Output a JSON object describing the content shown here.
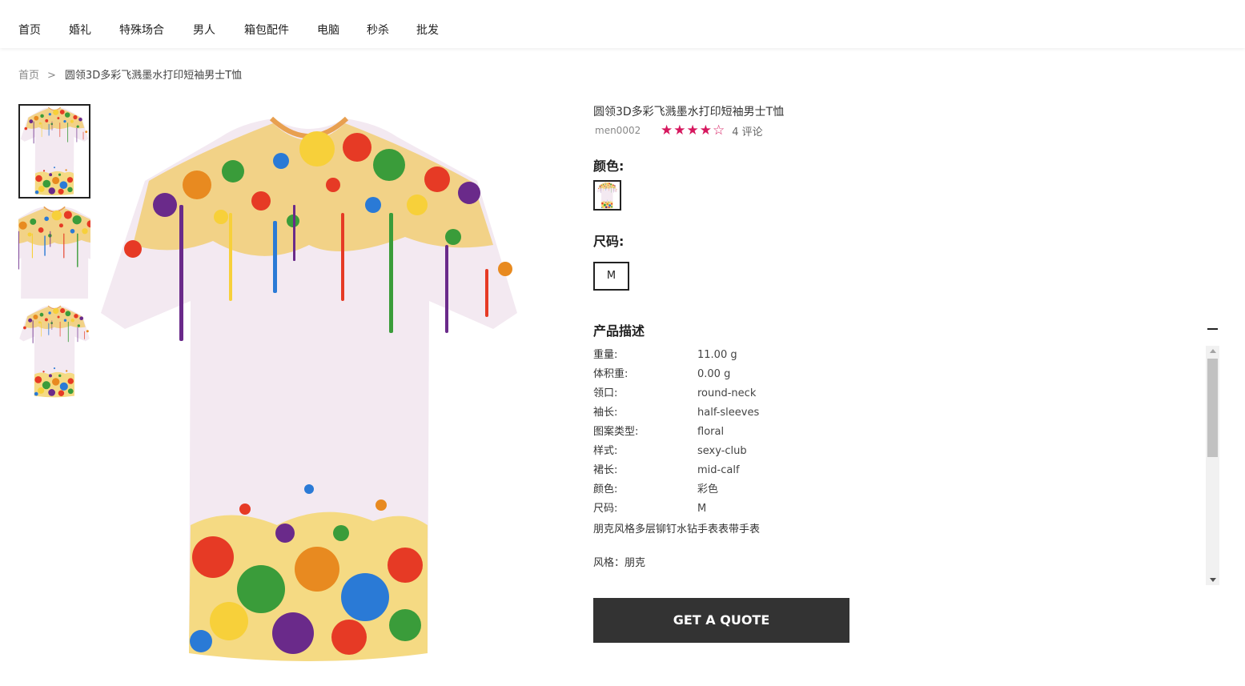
{
  "nav": {
    "items": [
      "首页",
      "婚礼",
      "特殊场合",
      "男人",
      "箱包配件",
      "电脑",
      "秒杀",
      "批发"
    ]
  },
  "breadcrumb": {
    "home": "首页",
    "separator": ">",
    "current": "圆领3D多彩飞溅墨水打印短袖男士T恤"
  },
  "product": {
    "title": "圆领3D多彩飞溅墨水打印短袖男士T恤",
    "sku": "men0002",
    "rating": 4,
    "rating_max": 5,
    "stars_text": "★★★★☆",
    "reviews": "4 评论",
    "color_label": "颜色:",
    "size_label": "尺码:",
    "size_selected": "M",
    "description_title": "产品描述",
    "attributes": [
      {
        "key": "重量:",
        "value": "11.00 g"
      },
      {
        "key": "体积重:",
        "value": "0.00 g"
      },
      {
        "key": "领口:",
        "value": "round-neck"
      },
      {
        "key": "袖长:",
        "value": "half-sleeves"
      },
      {
        "key": "图案类型:",
        "value": "floral"
      },
      {
        "key": "样式:",
        "value": "sexy-club"
      },
      {
        "key": "裙长:",
        "value": "mid-calf"
      },
      {
        "key": "颜色:",
        "value": "彩色"
      },
      {
        "key": "尺码:",
        "value": "M"
      }
    ],
    "description_text": "朋克风格多层铆钉水钻手表表带手表",
    "style_line": "风格：朋克",
    "quote_button": "GET A QUOTE"
  },
  "colors": {
    "accent_star": "#d6175e",
    "button_bg": "#333333"
  }
}
